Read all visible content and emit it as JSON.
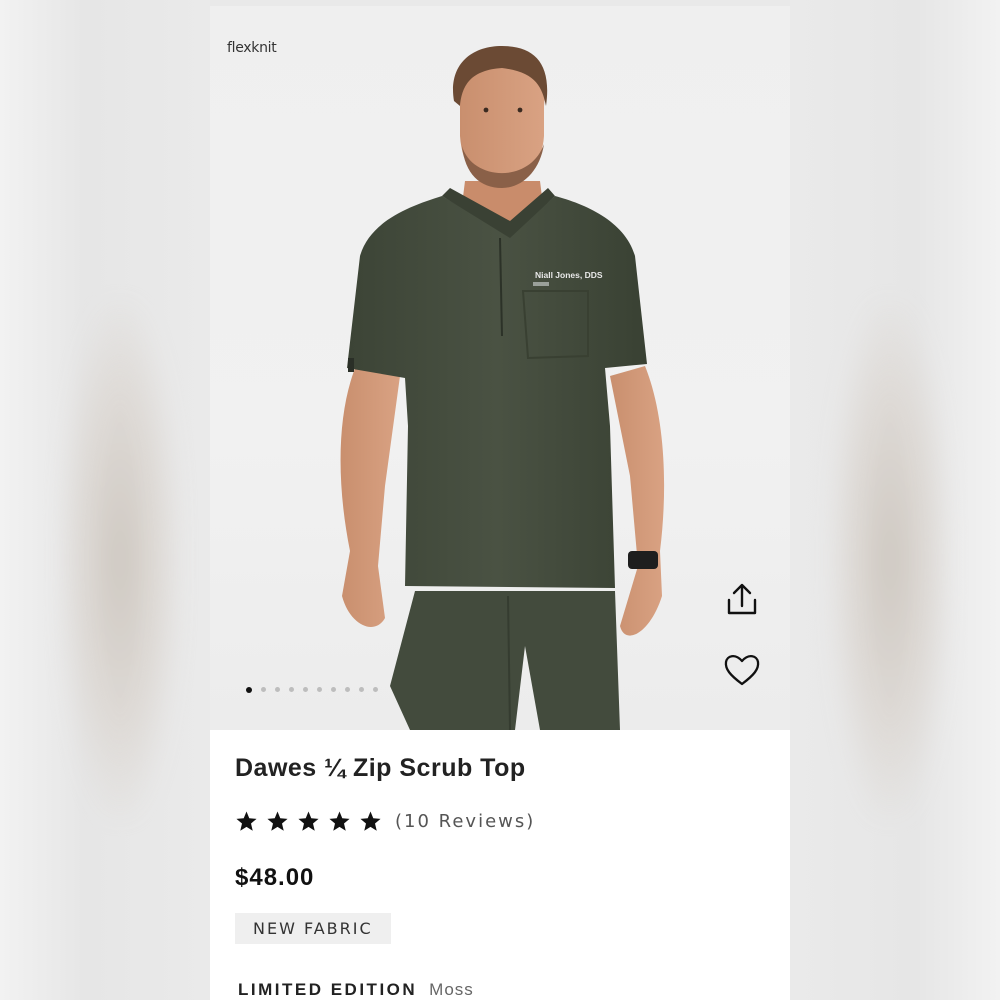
{
  "brand": "flexknit",
  "product": {
    "title": "Dawes ¼ Zip Scrub Top",
    "rating": 5,
    "reviews_label": "(10 Reviews)",
    "price": "$48.00",
    "badge": "NEW FABRIC",
    "edition_label": "LIMITED EDITION",
    "color": "Moss",
    "embroidery": "Niall Jones, DDS"
  },
  "gallery": {
    "total_images": 10,
    "active_index": 0
  },
  "actions": {
    "share_icon": "share-icon",
    "favorite_icon": "heart-icon"
  },
  "colors": {
    "scrub": "#41493a",
    "accent": "#111111",
    "badge_bg": "#efefef"
  }
}
